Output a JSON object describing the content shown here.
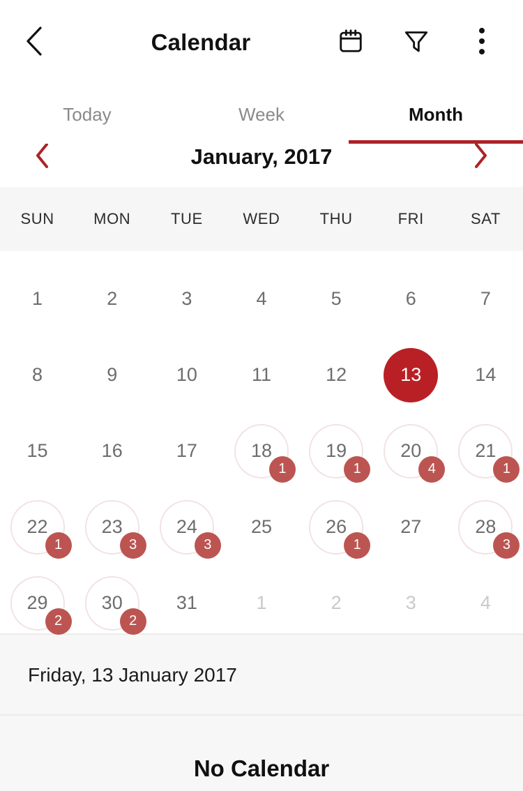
{
  "appbar": {
    "back_icon": "chevron-left-icon",
    "title": "Calendar",
    "actions": [
      {
        "icon": "calendar-icon",
        "name": "calendar-view-button"
      },
      {
        "icon": "filter-icon",
        "name": "filter-button"
      },
      {
        "icon": "overflow-menu-icon",
        "name": "overflow-menu-button"
      }
    ]
  },
  "tabs": [
    {
      "label": "Today",
      "active": false
    },
    {
      "label": "Week",
      "active": false
    },
    {
      "label": "Month",
      "active": true
    }
  ],
  "month_nav": {
    "prev_icon": "chevron-left-icon",
    "next_icon": "chevron-right-icon",
    "label": "January, 2017"
  },
  "weekdays": [
    "SUN",
    "MON",
    "TUE",
    "WED",
    "THU",
    "FRI",
    "SAT"
  ],
  "calendar": {
    "month": "January",
    "year": "2017",
    "selected_day": "13",
    "days": [
      {
        "num": "1",
        "other_month": false,
        "badge": null,
        "selected": false
      },
      {
        "num": "2",
        "other_month": false,
        "badge": null,
        "selected": false
      },
      {
        "num": "3",
        "other_month": false,
        "badge": null,
        "selected": false
      },
      {
        "num": "4",
        "other_month": false,
        "badge": null,
        "selected": false
      },
      {
        "num": "5",
        "other_month": false,
        "badge": null,
        "selected": false
      },
      {
        "num": "6",
        "other_month": false,
        "badge": null,
        "selected": false
      },
      {
        "num": "7",
        "other_month": false,
        "badge": null,
        "selected": false
      },
      {
        "num": "8",
        "other_month": false,
        "badge": null,
        "selected": false
      },
      {
        "num": "9",
        "other_month": false,
        "badge": null,
        "selected": false
      },
      {
        "num": "10",
        "other_month": false,
        "badge": null,
        "selected": false
      },
      {
        "num": "11",
        "other_month": false,
        "badge": null,
        "selected": false
      },
      {
        "num": "12",
        "other_month": false,
        "badge": null,
        "selected": false
      },
      {
        "num": "13",
        "other_month": false,
        "badge": null,
        "selected": true
      },
      {
        "num": "14",
        "other_month": false,
        "badge": null,
        "selected": false
      },
      {
        "num": "15",
        "other_month": false,
        "badge": null,
        "selected": false
      },
      {
        "num": "16",
        "other_month": false,
        "badge": null,
        "selected": false
      },
      {
        "num": "17",
        "other_month": false,
        "badge": null,
        "selected": false
      },
      {
        "num": "18",
        "other_month": false,
        "badge": "1",
        "selected": false
      },
      {
        "num": "19",
        "other_month": false,
        "badge": "1",
        "selected": false
      },
      {
        "num": "20",
        "other_month": false,
        "badge": "4",
        "selected": false
      },
      {
        "num": "21",
        "other_month": false,
        "badge": "1",
        "selected": false
      },
      {
        "num": "22",
        "other_month": false,
        "badge": "1",
        "selected": false
      },
      {
        "num": "23",
        "other_month": false,
        "badge": "3",
        "selected": false
      },
      {
        "num": "24",
        "other_month": false,
        "badge": "3",
        "selected": false
      },
      {
        "num": "25",
        "other_month": false,
        "badge": null,
        "selected": false
      },
      {
        "num": "26",
        "other_month": false,
        "badge": "1",
        "selected": false
      },
      {
        "num": "27",
        "other_month": false,
        "badge": null,
        "selected": false
      },
      {
        "num": "28",
        "other_month": false,
        "badge": "3",
        "selected": false
      },
      {
        "num": "29",
        "other_month": false,
        "badge": "2",
        "selected": false
      },
      {
        "num": "30",
        "other_month": false,
        "badge": "2",
        "selected": false
      },
      {
        "num": "31",
        "other_month": false,
        "badge": null,
        "selected": false
      },
      {
        "num": "1",
        "other_month": true,
        "badge": null,
        "selected": false
      },
      {
        "num": "2",
        "other_month": true,
        "badge": null,
        "selected": false
      },
      {
        "num": "3",
        "other_month": true,
        "badge": null,
        "selected": false
      },
      {
        "num": "4",
        "other_month": true,
        "badge": null,
        "selected": false
      }
    ]
  },
  "bottom": {
    "selected_date_label": "Friday, 13 January 2017",
    "no_calendar_label": "No Calendar"
  },
  "colors": {
    "accent_red": "#b92025",
    "badge_red": "#bc5552",
    "ring_pink": "#f3e2e2",
    "tab_underline": "#ad2226"
  }
}
